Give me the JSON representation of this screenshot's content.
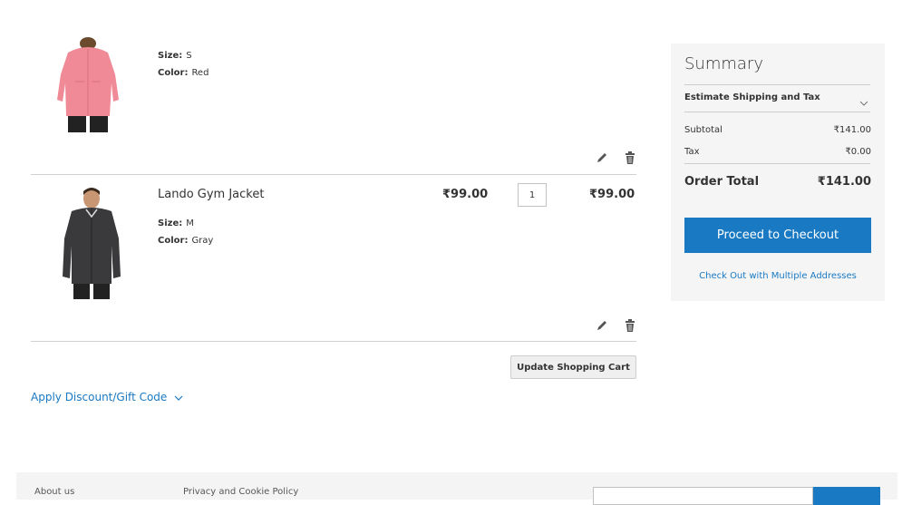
{
  "cart": {
    "items": [
      {
        "name": "",
        "options": [
          {
            "label": "Size:",
            "value": "S"
          },
          {
            "label": "Color:",
            "value": "Red"
          }
        ],
        "image_icon": "pink-jacket-image",
        "image_color": "#f08a97"
      },
      {
        "name": "Lando Gym Jacket",
        "price": "₹99.00",
        "qty": "1",
        "subtotal": "₹99.00",
        "options": [
          {
            "label": "Size:",
            "value": "M"
          },
          {
            "label": "Color:",
            "value": "Gray"
          }
        ],
        "image_icon": "gray-jacket-image",
        "image_color": "#3a3a3c"
      }
    ],
    "update_label": "Update Shopping Cart",
    "edit_icon": "pencil-icon",
    "delete_icon": "trash-icon"
  },
  "discount": {
    "label": "Apply Discount/Gift Code"
  },
  "summary": {
    "title": "Summary",
    "estimate_label": "Estimate Shipping and Tax",
    "subtotal_label": "Subtotal",
    "subtotal_value": "₹141.00",
    "tax_label": "Tax",
    "tax_value": "₹0.00",
    "order_total_label": "Order Total",
    "order_total_value": "₹141.00",
    "checkout_label": "Proceed to Checkout",
    "multi_label": "Check Out with Multiple Addresses"
  },
  "footer": {
    "links": [
      "About us",
      "Privacy and Cookie Policy"
    ]
  },
  "colors": {
    "accent": "#1979c3",
    "summary_bg": "#f5f5f5"
  }
}
